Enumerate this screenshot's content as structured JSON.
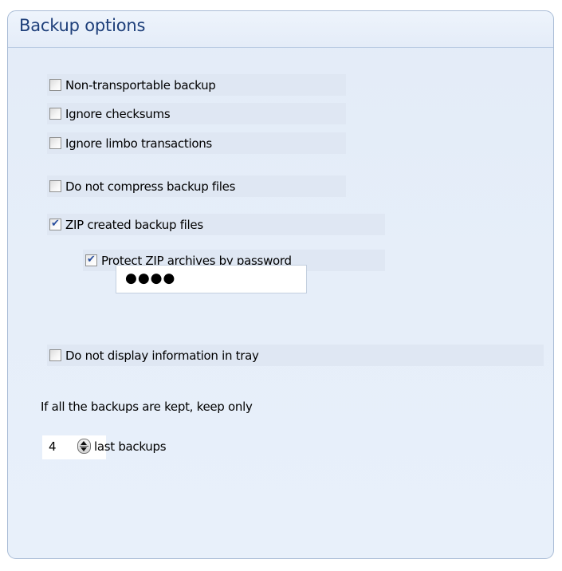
{
  "panel": {
    "title": "Backup options"
  },
  "options": {
    "non_transportable": {
      "label": "Non-transportable backup",
      "checked": false
    },
    "ignore_checksums": {
      "label": "Ignore checksums",
      "checked": false
    },
    "ignore_limbo": {
      "label": "Ignore limbo transactions",
      "checked": false
    },
    "no_compress": {
      "label": "Do not compress backup files",
      "checked": false
    },
    "zip_files": {
      "label": "ZIP created backup files",
      "checked": true
    },
    "protect_zip": {
      "label": "Protect ZIP archives by password",
      "checked": true
    },
    "no_tray_info": {
      "label": "Do not display information in tray",
      "checked": false
    }
  },
  "password": {
    "masked_value": "●●●●"
  },
  "keep": {
    "label": "If all the backups are kept, keep only",
    "value": "4",
    "suffix": "last backups"
  },
  "icons": {
    "checkmark": "✔"
  },
  "colors": {
    "title": "#1e3f7a",
    "panel_bg": "#e6eef9",
    "row_bg": "#dfe7f3",
    "check": "#2a4f9e"
  }
}
